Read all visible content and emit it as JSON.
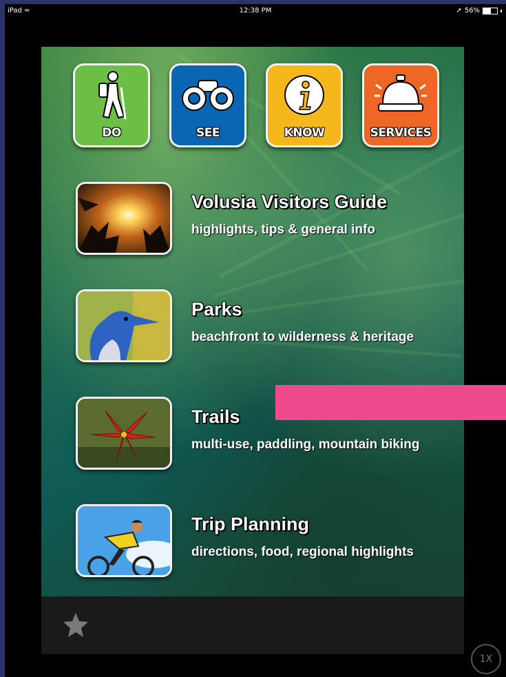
{
  "status_bar": {
    "device": "iPad",
    "time": "12:38 PM",
    "battery": "56%"
  },
  "categories": [
    {
      "label": "DO",
      "color": "#6cbe45",
      "icon": "hiker-icon"
    },
    {
      "label": "SEE",
      "color": "#0a66b0",
      "icon": "binoculars-icon"
    },
    {
      "label": "KNOW",
      "color": "#f5b81a",
      "icon": "info-icon"
    },
    {
      "label": "SERVICES",
      "color": "#ee6624",
      "icon": "service-bell-icon"
    }
  ],
  "menu": [
    {
      "title": "Volusia Visitors Guide",
      "subtitle": "highlights, tips & general info",
      "thumb": "sunset-palm-photo"
    },
    {
      "title": "Parks",
      "subtitle": "beachfront to wilderness & heritage",
      "thumb": "scrub-jay-photo"
    },
    {
      "title": "Trails",
      "subtitle": "multi-use, paddling, mountain biking",
      "thumb": "red-lily-photo"
    },
    {
      "title": "Trip Planning",
      "subtitle": "directions, food, regional highlights",
      "thumb": "cyclist-photo"
    }
  ],
  "tabbar": {
    "icon": "star-icon"
  },
  "zoom_label": "1X",
  "colors": {
    "redaction": "#ec4c8e",
    "tabbar": "#1a1a1a"
  }
}
